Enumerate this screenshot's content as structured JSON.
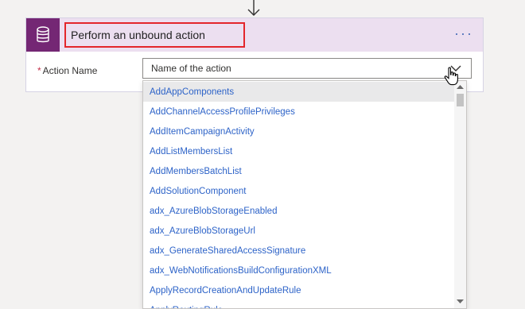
{
  "card": {
    "title": "Perform an unbound action",
    "more_label": "···",
    "field_label": "Action Name",
    "required_mark": "*",
    "select_placeholder": "Name of the action"
  },
  "dropdown": {
    "items": [
      "AddAppComponents",
      "AddChannelAccessProfilePrivileges",
      "AddItemCampaignActivity",
      "AddListMembersList",
      "AddMembersBatchList",
      "AddSolutionComponent",
      "adx_AzureBlobStorageEnabled",
      "adx_AzureBlobStorageUrl",
      "adx_GenerateSharedAccessSignature",
      "adx_WebNotificationsBuildConfigurationXML",
      "ApplyRecordCreationAndUpdateRule",
      "ApplyRoutingRule"
    ],
    "highlighted_index": 0
  },
  "colors": {
    "accent": "#742774",
    "header_bg": "#ecdff0",
    "highlight_border": "#e3262b",
    "link": "#2d63c8"
  },
  "icons": {
    "connector": "database-icon",
    "flow_arrow": "arrow-down-icon",
    "dropdown": "chevron-down-icon",
    "pointer": "hand-cursor-icon"
  }
}
